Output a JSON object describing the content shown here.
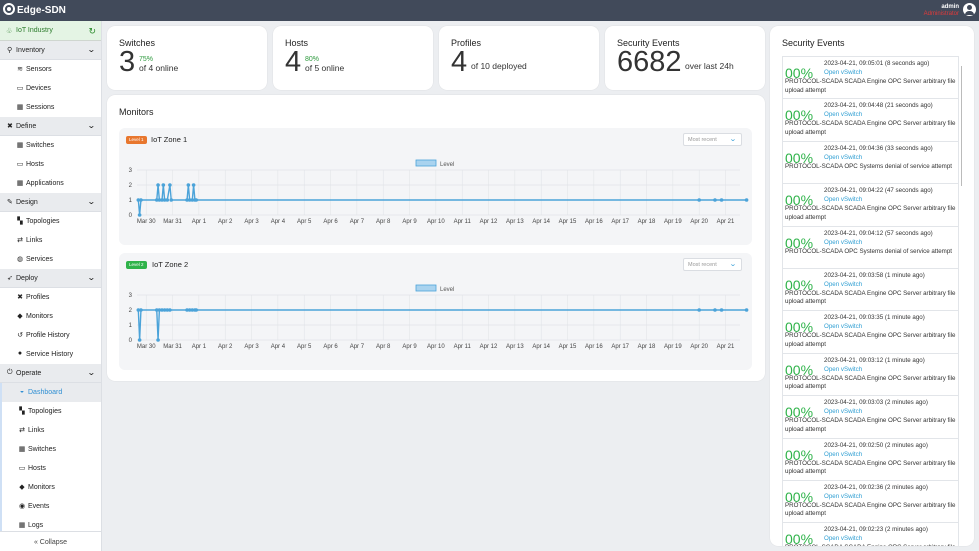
{
  "app": {
    "title": "Edge-SDN",
    "user": "admin",
    "role": "Administrator"
  },
  "sidebar": {
    "workspace": "IoT Industry",
    "sections": [
      {
        "label": "Inventory",
        "icon": "search-icon",
        "items": [
          {
            "label": "Sensors",
            "icon": "wifi-icon"
          },
          {
            "label": "Devices",
            "icon": "monitor-icon"
          },
          {
            "label": "Sessions",
            "icon": "grid-icon"
          }
        ]
      },
      {
        "label": "Define",
        "icon": "tools-icon",
        "items": [
          {
            "label": "Switches",
            "icon": "grid-icon"
          },
          {
            "label": "Hosts",
            "icon": "monitor-icon"
          },
          {
            "label": "Applications",
            "icon": "grid-icon"
          }
        ]
      },
      {
        "label": "Design",
        "icon": "pencil-ruler-icon",
        "items": [
          {
            "label": "Topologies",
            "icon": "map-icon"
          },
          {
            "label": "Links",
            "icon": "exchange-icon"
          },
          {
            "label": "Services",
            "icon": "globe-icon"
          }
        ]
      },
      {
        "label": "Deploy",
        "icon": "rocket-icon",
        "items": [
          {
            "label": "Profiles",
            "icon": "tools-icon"
          },
          {
            "label": "Monitors",
            "icon": "shield-icon"
          },
          {
            "label": "Profile History",
            "icon": "history-icon"
          },
          {
            "label": "Service History",
            "icon": "info-icon"
          }
        ]
      },
      {
        "label": "Operate",
        "icon": "power-icon",
        "items": [
          {
            "label": "Dashboard",
            "icon": "dashboard-icon",
            "active": true
          },
          {
            "label": "Topologies",
            "icon": "map-icon"
          },
          {
            "label": "Links",
            "icon": "exchange-icon"
          },
          {
            "label": "Switches",
            "icon": "grid-icon"
          },
          {
            "label": "Hosts",
            "icon": "monitor-icon"
          },
          {
            "label": "Monitors",
            "icon": "shield-icon"
          },
          {
            "label": "Events",
            "icon": "eye-icon"
          },
          {
            "label": "Logs",
            "icon": "grid-icon"
          }
        ]
      }
    ],
    "collapse": "Collapse"
  },
  "stats": [
    {
      "title": "Switches",
      "value": "3",
      "pct": "75%",
      "sub": "of 4 online"
    },
    {
      "title": "Hosts",
      "value": "4",
      "pct": "80%",
      "sub": "of 5 online"
    },
    {
      "title": "Profiles",
      "value": "4",
      "pct": "",
      "sub": "of 10 deployed"
    },
    {
      "title": "Security Events",
      "value": "6682",
      "pct": "",
      "sub": "over last 24h"
    }
  ],
  "monitors": {
    "title": "Monitors",
    "zones": [
      {
        "badge": "Level 1",
        "badge_color": "#e8772e",
        "name": "IoT Zone 1",
        "select": "Most recent",
        "legend": "Level"
      },
      {
        "badge": "Level 2",
        "badge_color": "#2fb34a",
        "name": "IoT Zone 2",
        "select": "Most recent",
        "legend": "Level"
      }
    ]
  },
  "chart_data": [
    {
      "type": "line",
      "title": "IoT Zone 1",
      "legend": [
        "Level"
      ],
      "categories": [
        "Mar 30",
        "Mar 31",
        "Apr 1",
        "Apr 2",
        "Apr 3",
        "Apr 4",
        "Apr 5",
        "Apr 6",
        "Apr 7",
        "Apr 8",
        "Apr 9",
        "Apr 10",
        "Apr 11",
        "Apr 12",
        "Apr 13",
        "Apr 14",
        "Apr 15",
        "Apr 16",
        "Apr 17",
        "Apr 18",
        "Apr 19",
        "Apr 20",
        "Apr 21"
      ],
      "yticks": [
        "0",
        "1",
        "2",
        "3"
      ],
      "ylim": [
        0,
        3
      ],
      "grid": true,
      "points": [
        [
          -0.3,
          1
        ],
        [
          -0.25,
          0
        ],
        [
          -0.2,
          1
        ],
        [
          0.4,
          1
        ],
        [
          0.45,
          2
        ],
        [
          0.5,
          1
        ],
        [
          0.6,
          1
        ],
        [
          0.65,
          2
        ],
        [
          0.7,
          1
        ],
        [
          0.8,
          1
        ],
        [
          0.9,
          2
        ],
        [
          0.95,
          1
        ],
        [
          1.55,
          1
        ],
        [
          1.6,
          2
        ],
        [
          1.65,
          1
        ],
        [
          1.75,
          1
        ],
        [
          1.8,
          2
        ],
        [
          1.85,
          1
        ],
        [
          1.9,
          1
        ],
        [
          21.0,
          1
        ],
        [
          21.6,
          1
        ],
        [
          21.85,
          1
        ],
        [
          22.8,
          1
        ]
      ]
    },
    {
      "type": "line",
      "title": "IoT Zone 2",
      "legend": [
        "Level"
      ],
      "categories": [
        "Mar 30",
        "Mar 31",
        "Apr 1",
        "Apr 2",
        "Apr 3",
        "Apr 4",
        "Apr 5",
        "Apr 6",
        "Apr 7",
        "Apr 8",
        "Apr 9",
        "Apr 10",
        "Apr 11",
        "Apr 12",
        "Apr 13",
        "Apr 14",
        "Apr 15",
        "Apr 16",
        "Apr 17",
        "Apr 18",
        "Apr 19",
        "Apr 20",
        "Apr 21"
      ],
      "yticks": [
        "0",
        "1",
        "2",
        "3"
      ],
      "ylim": [
        0,
        3
      ],
      "grid": true,
      "points": [
        [
          -0.3,
          2
        ],
        [
          -0.25,
          0
        ],
        [
          -0.2,
          2
        ],
        [
          0.4,
          2
        ],
        [
          0.45,
          0
        ],
        [
          0.5,
          2
        ],
        [
          0.6,
          2
        ],
        [
          0.7,
          2
        ],
        [
          0.8,
          2
        ],
        [
          0.9,
          2
        ],
        [
          1.55,
          2
        ],
        [
          1.65,
          2
        ],
        [
          1.75,
          2
        ],
        [
          1.85,
          2
        ],
        [
          1.9,
          2
        ],
        [
          21.0,
          2
        ],
        [
          21.6,
          2
        ],
        [
          21.85,
          2
        ],
        [
          22.8,
          2
        ]
      ]
    }
  ],
  "events": {
    "title": "Security Events",
    "link": "Open vSwitch",
    "items": [
      {
        "pct": "00%",
        "time": "2023-04-21, 09:05:01 (8 seconds ago)",
        "desc": "PROTOCOL-SCADA SCADA Engine OPC Server arbitrary file upload attempt"
      },
      {
        "pct": "00%",
        "time": "2023-04-21, 09:04:48 (21 seconds ago)",
        "desc": "PROTOCOL-SCADA SCADA Engine OPC Server arbitrary file upload attempt"
      },
      {
        "pct": "00%",
        "time": "2023-04-21, 09:04:36 (33 seconds ago)",
        "desc": "PROTOCOL-SCADA OPC Systems denial of service attempt"
      },
      {
        "pct": "00%",
        "time": "2023-04-21, 09:04:22 (47 seconds ago)",
        "desc": "PROTOCOL-SCADA SCADA Engine OPC Server arbitrary file upload attempt"
      },
      {
        "pct": "00%",
        "time": "2023-04-21, 09:04:12 (57 seconds ago)",
        "desc": "PROTOCOL-SCADA OPC Systems denial of service attempt"
      },
      {
        "pct": "00%",
        "time": "2023-04-21, 09:03:58 (1 minute ago)",
        "desc": "PROTOCOL-SCADA SCADA Engine OPC Server arbitrary file upload attempt"
      },
      {
        "pct": "00%",
        "time": "2023-04-21, 09:03:35 (1 minute ago)",
        "desc": "PROTOCOL-SCADA SCADA Engine OPC Server arbitrary file upload attempt"
      },
      {
        "pct": "00%",
        "time": "2023-04-21, 09:03:12 (1 minute ago)",
        "desc": "PROTOCOL-SCADA SCADA Engine OPC Server arbitrary file upload attempt"
      },
      {
        "pct": "00%",
        "time": "2023-04-21, 09:03:03 (2 minutes ago)",
        "desc": "PROTOCOL-SCADA SCADA Engine OPC Server arbitrary file upload attempt"
      },
      {
        "pct": "00%",
        "time": "2023-04-21, 09:02:50 (2 minutes ago)",
        "desc": "PROTOCOL-SCADA SCADA Engine OPC Server arbitrary file upload attempt"
      },
      {
        "pct": "00%",
        "time": "2023-04-21, 09:02:36 (2 minutes ago)",
        "desc": "PROTOCOL-SCADA SCADA Engine OPC Server arbitrary file upload attempt"
      },
      {
        "pct": "00%",
        "time": "2023-04-21, 09:02:23 (2 minutes ago)",
        "desc": "PROTOCOL-SCADA SCADA Engine OPC Server arbitrary file upload attempt"
      }
    ]
  },
  "colors": {
    "accent": "#2f9fd3",
    "ok": "#2fb34a",
    "topbar": "#414a5a",
    "line": "#4ba3d9"
  }
}
